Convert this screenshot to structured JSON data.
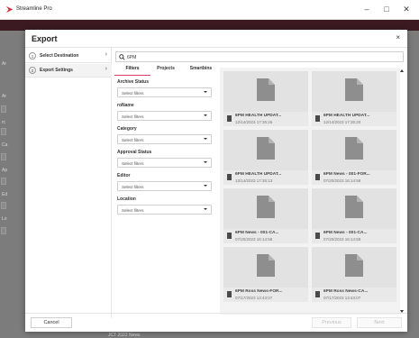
{
  "os": {
    "app_title": "Streamline Pro",
    "minimize": "–",
    "maximize": "□",
    "close": "✕"
  },
  "background": {
    "left_labels": [
      "Ar",
      "Ar",
      "rc",
      "Ca",
      "Ap",
      "Ed",
      "Lo"
    ],
    "bottom_peek": "JCT 2022 News"
  },
  "modal": {
    "title": "Export",
    "close": "×",
    "steps": [
      {
        "num": "1",
        "label": "Select Destination",
        "active": false
      },
      {
        "num": "2",
        "label": "Export Settings",
        "active": true
      }
    ],
    "search": {
      "value": "6PM"
    },
    "tabs": [
      "Filters",
      "Projects",
      "Smartbins"
    ],
    "active_tab": "Filters",
    "filters": [
      {
        "label": "Archive Status",
        "value": "Select filters"
      },
      {
        "label": "roName",
        "value": "Select filters"
      },
      {
        "label": "Category",
        "value": "Select filters"
      },
      {
        "label": "Approval Status",
        "value": "Select filters"
      },
      {
        "label": "Editor",
        "value": "Select filters"
      },
      {
        "label": "Location",
        "value": "Select filters"
      }
    ],
    "cards": [
      {
        "title": "6PM HEALTH UPDAT...",
        "date": "12/14/2023 17:35:26"
      },
      {
        "title": "6PM HEALTH UPDAT...",
        "date": "12/14/2023 17:35:20"
      },
      {
        "title": "6PM HEALTH UPDAT...",
        "date": "12/14/2023 17:35:13"
      },
      {
        "title": "6PM News - 001-FOR...",
        "date": "07/20/2023 16:14:58"
      },
      {
        "title": "6PM News - 001-CA...",
        "date": "07/20/2023 16:14:58"
      },
      {
        "title": "6PM News - 001-CA...",
        "date": "07/20/2023 16:14:58"
      },
      {
        "title": "6PM Ross News-FOR...",
        "date": "07/17/2023 13:43:07"
      },
      {
        "title": "6PM Ross News-CA...",
        "date": "07/17/2023 13:43:07"
      }
    ],
    "footer": {
      "cancel": "Cancel",
      "previous": "Previous",
      "next": "Next"
    }
  }
}
